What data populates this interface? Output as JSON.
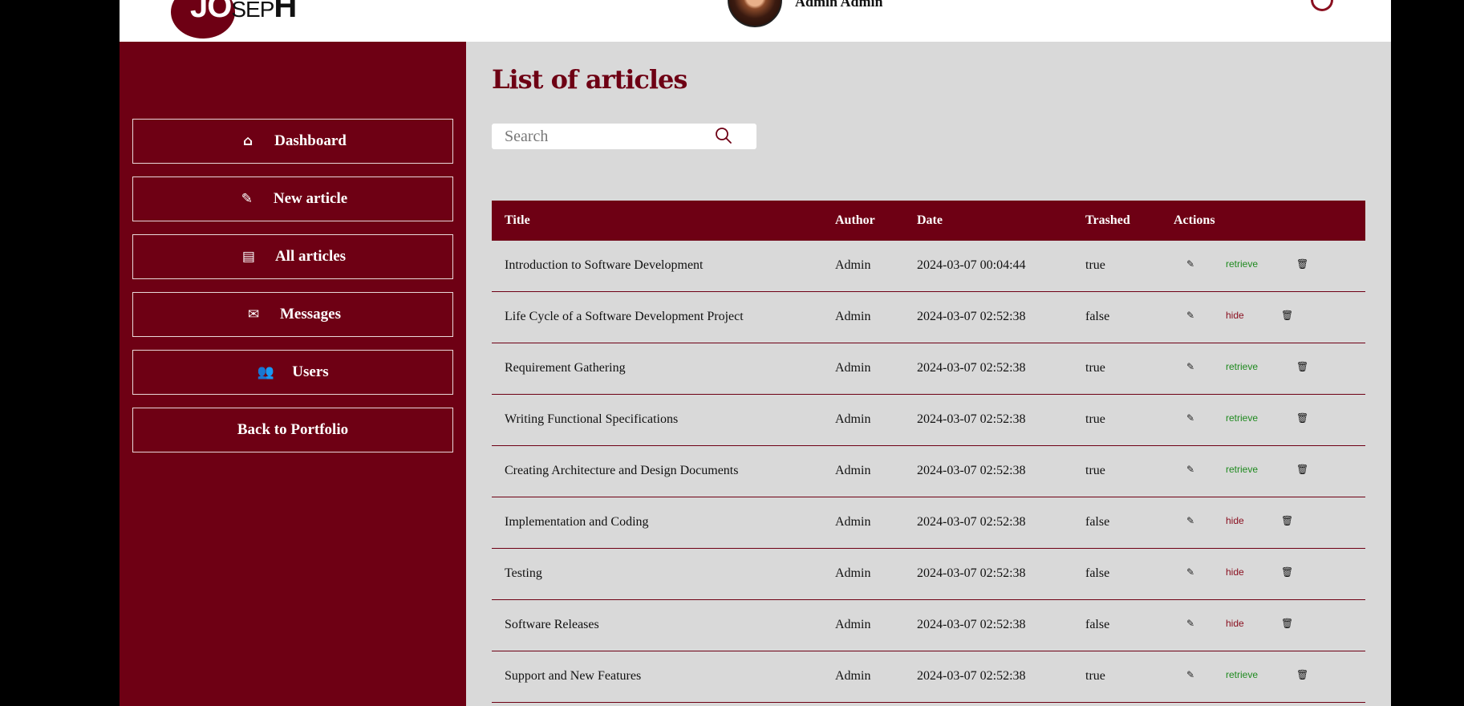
{
  "header": {
    "logo": {
      "main": "JO",
      "small": "SEP",
      "end": "H"
    },
    "user_name": "Admin Admin"
  },
  "sidebar": {
    "items": [
      {
        "label": "Dashboard",
        "icon": "home-icon",
        "glyph": "⌂"
      },
      {
        "label": "New article",
        "icon": "pencil-icon",
        "glyph": "✎"
      },
      {
        "label": "All articles",
        "icon": "book-icon",
        "glyph": "▤"
      },
      {
        "label": "Messages",
        "icon": "envelope-icon",
        "glyph": "✉"
      },
      {
        "label": "Users",
        "icon": "users-icon",
        "glyph": "👥"
      },
      {
        "label": "Back to Portfolio",
        "icon": "",
        "glyph": ""
      }
    ]
  },
  "main": {
    "title": "List of articles",
    "search": {
      "placeholder": "Search",
      "value": ""
    },
    "table": {
      "headers": {
        "title": "Title",
        "author": "Author",
        "date": "Date",
        "trashed": "Trashed",
        "actions": "Actions"
      },
      "rows": [
        {
          "title": "Introduction to Software Development",
          "author": "Admin",
          "date": "2024-03-07 00:04:44",
          "trashed": "true",
          "toggle": "retrieve"
        },
        {
          "title": "Life Cycle of a Software Development Project",
          "author": "Admin",
          "date": "2024-03-07 02:52:38",
          "trashed": "false",
          "toggle": "hide"
        },
        {
          "title": "Requirement Gathering",
          "author": "Admin",
          "date": "2024-03-07 02:52:38",
          "trashed": "true",
          "toggle": "retrieve"
        },
        {
          "title": "Writing Functional Specifications",
          "author": "Admin",
          "date": "2024-03-07 02:52:38",
          "trashed": "true",
          "toggle": "retrieve"
        },
        {
          "title": "Creating Architecture and Design Documents",
          "author": "Admin",
          "date": "2024-03-07 02:52:38",
          "trashed": "true",
          "toggle": "retrieve"
        },
        {
          "title": "Implementation and Coding",
          "author": "Admin",
          "date": "2024-03-07 02:52:38",
          "trashed": "false",
          "toggle": "hide"
        },
        {
          "title": "Testing",
          "author": "Admin",
          "date": "2024-03-07 02:52:38",
          "trashed": "false",
          "toggle": "hide"
        },
        {
          "title": "Software Releases",
          "author": "Admin",
          "date": "2024-03-07 02:52:38",
          "trashed": "false",
          "toggle": "hide"
        },
        {
          "title": "Support and New Features",
          "author": "Admin",
          "date": "2024-03-07 02:52:38",
          "trashed": "true",
          "toggle": "retrieve"
        }
      ]
    }
  },
  "colors": {
    "brand": "#6e0014",
    "background": "#d9d9d9",
    "retrieve": "#1f8a1f",
    "hide": "#8a1020"
  }
}
